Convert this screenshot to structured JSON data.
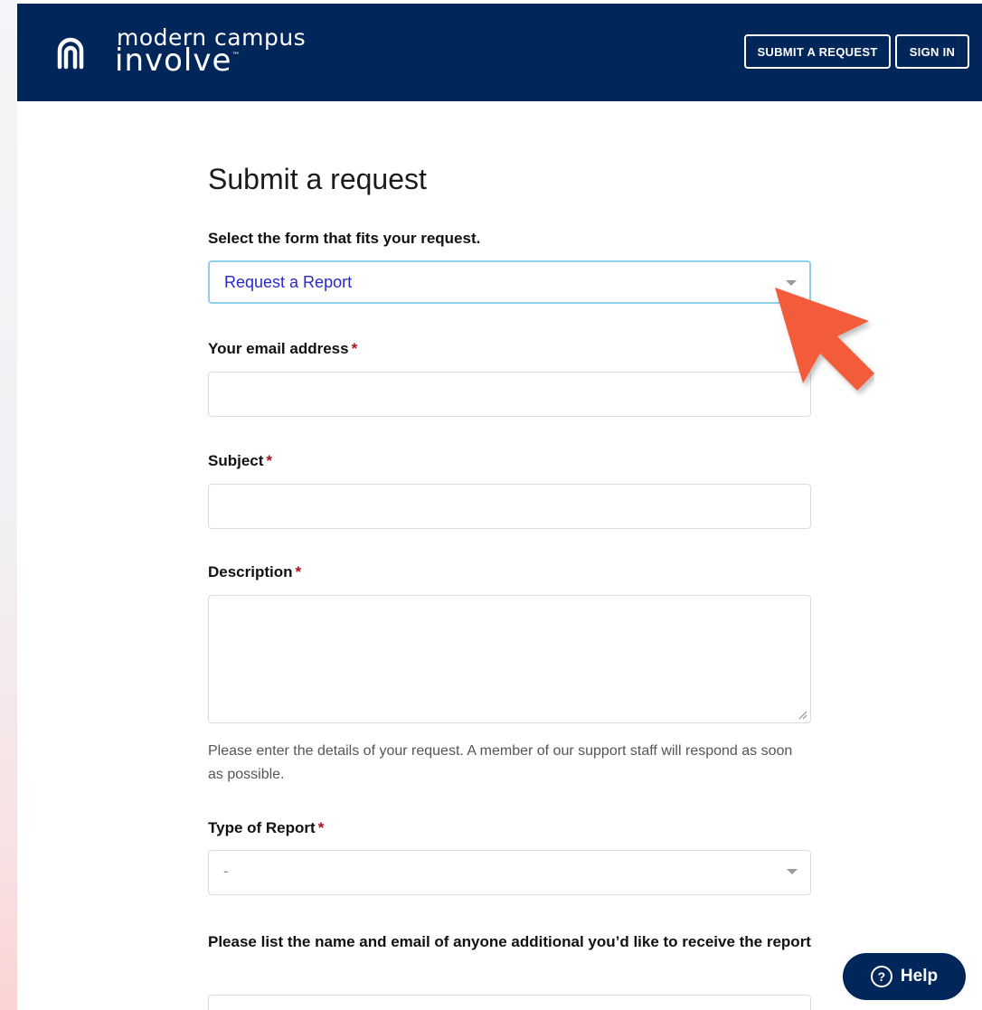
{
  "header": {
    "brand_top": "modern campus",
    "brand_main": "involve",
    "brand_tm": "™",
    "submit_label": "SUBMIT A REQUEST",
    "signin_label": "SIGN IN",
    "background": "#01275a"
  },
  "form": {
    "title": "Submit a request",
    "select_form_label": "Select the form that fits your request.",
    "select_form_value": "Request a Report",
    "email_label": "Your email address",
    "email_value": "",
    "subject_label": "Subject",
    "subject_value": "",
    "description_label": "Description",
    "description_value": "",
    "description_hint": "Please enter the details of your request. A member of our support staff will respond as soon as possible.",
    "report_type_label": "Type of Report",
    "report_type_value": "-",
    "additional_label": "Please list the name and email of anyone additional you’d like to receive the report",
    "additional_value": "",
    "required_marker": "*"
  },
  "help_button": {
    "icon": "question-circle-icon",
    "icon_glyph": "?",
    "label": "Help"
  },
  "annotation": {
    "icon": "arrow-pointer-icon",
    "color": "#f25c3b"
  }
}
